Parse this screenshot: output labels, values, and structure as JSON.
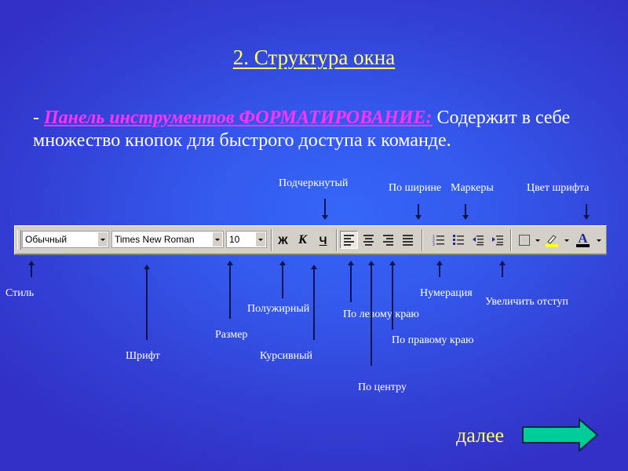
{
  "slide": {
    "title": "2. Структура окна",
    "description_prefix": "- ",
    "description_emphasis": "Панель инструментов ФОРМАТИРОВАНИЕ:",
    "description_rest": " Содержит в себе множество кнопок для быстрого доступа к команде."
  },
  "toolbar": {
    "style_value": "Обычный",
    "font_value": "Times New Roman",
    "size_value": "10",
    "bold_glyph": "Ж",
    "italic_glyph": "К",
    "underline_glyph": "Ч",
    "font_color_glyph": "A",
    "highlight_color": "#ffff33",
    "font_color": "#000000"
  },
  "labels": {
    "underline": "Подчеркнутый",
    "justify": "По ширине",
    "bullets": "Маркеры",
    "font_color": "Цвет  шрифта",
    "style": "Стиль",
    "font": "Шрифт",
    "size": "Размер",
    "bold": "Полужирный",
    "italic": "Курсивный",
    "align_left": "По левому краю",
    "align_center": "По центру",
    "align_right": "По правому краю",
    "numbering": "Нумерация",
    "increase_indent": "Увеличить отступ"
  },
  "navigation": {
    "next_label": "далее"
  },
  "colors": {
    "title": "#ffff66",
    "emphasis": "#ff33ff",
    "arrow_fill": "#00cc99",
    "label": "#ffffff"
  }
}
